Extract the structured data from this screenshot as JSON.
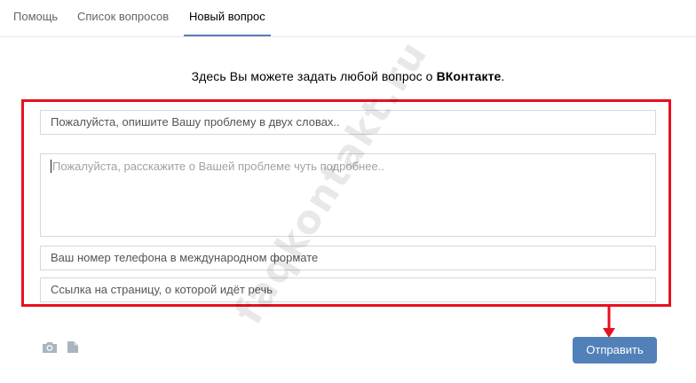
{
  "tabs": [
    {
      "label": "Помощь"
    },
    {
      "label": "Список вопросов"
    },
    {
      "label": "Новый вопрос",
      "active": true
    }
  ],
  "intro": {
    "text_before": "Здесь Вы можете задать любой вопрос о ",
    "brand": "ВКонтакте",
    "text_after": "."
  },
  "form": {
    "title_placeholder": "Пожалуйста, опишите Вашу проблему в двух словах..",
    "details_placeholder": "Пожалуйста, расскажите о Вашей проблеме чуть подробнее..",
    "phone_placeholder": "Ваш номер телефона в международном формате",
    "link_placeholder": "Ссылка на страницу, о которой идёт речь"
  },
  "attachments": [
    {
      "icon": "camera-icon"
    },
    {
      "icon": "document-icon"
    }
  ],
  "send_label": "Отправить",
  "watermark": "faqkontakt.ru",
  "colors": {
    "accent": "#5181b8",
    "highlight": "#e8101f",
    "border": "#d3d9de"
  }
}
